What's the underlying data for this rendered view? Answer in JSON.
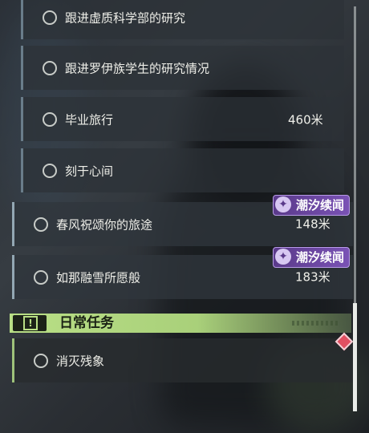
{
  "quests": [
    {
      "label": "跟进虚质科学部的研究",
      "distance": ""
    },
    {
      "label": "跟进罗伊族学生的研究情况",
      "distance": ""
    },
    {
      "label": "毕业旅行",
      "distance": "460米"
    },
    {
      "label": "刻于心间",
      "distance": ""
    },
    {
      "label": "春风祝颂你的旅途",
      "distance": "148米",
      "badge": "潮汐续闻"
    },
    {
      "label": "如那融雪所愿般",
      "distance": "183米",
      "badge": "潮汐续闻"
    }
  ],
  "daily_section": {
    "title": "日常任务",
    "icon": "exclamation-icon"
  },
  "daily_quests": [
    {
      "label": "消灭残象"
    }
  ],
  "colors": {
    "accent_green": "#b9df86",
    "badge_purple": "#7a52b5",
    "marker_red": "#e05062"
  }
}
